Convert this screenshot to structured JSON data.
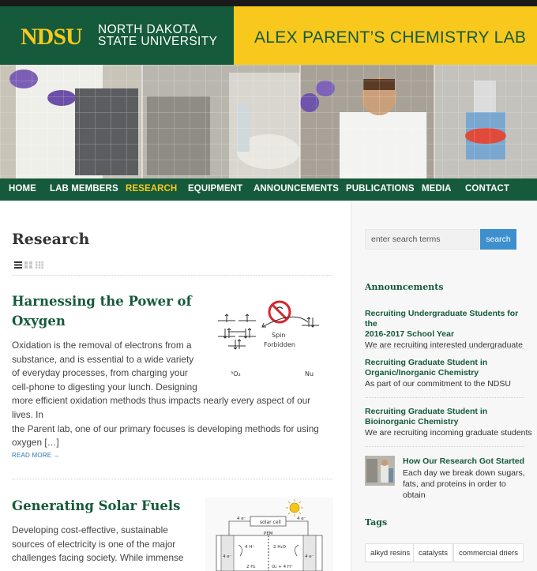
{
  "header": {
    "logo": "NDSU",
    "university_line1": "NORTH DAKOTA",
    "university_line2": "STATE UNIVERSITY",
    "lab_title": "ALEX PARENT’S CHEMISTRY LAB"
  },
  "nav": {
    "items": [
      {
        "label": "HOME"
      },
      {
        "label": "LAB MEMBERS"
      },
      {
        "label": "RESEARCH",
        "active": true
      },
      {
        "label": "EQUIPMENT"
      },
      {
        "label": "ANNOUNCEMENTS"
      },
      {
        "label": "PUBLICATIONS"
      },
      {
        "label": "MEDIA"
      },
      {
        "label": "CONTACT"
      }
    ]
  },
  "main": {
    "page_title": "Research",
    "posts": [
      {
        "title_line1": "Harnessing the Power of",
        "title_line2": "Oxygen",
        "excerpt_lines": [
          "Oxidation is the removal of electrons from a",
          "substance, and is essential to a wide variety",
          "of everyday processes, from charging your",
          "cell-phone to digesting your lunch. Designing",
          "more efficient oxidation methods thus impacts nearly every aspect of our lives. In",
          "the Parent lab, one of our primary focuses is developing methods for using",
          "oxygen […]"
        ],
        "read_more": "READ MORE →",
        "figure": {
          "spin_label_1": "Spin",
          "spin_label_2": "Forbidden",
          "label_o2": "³O₂",
          "label_nu": "Nu"
        }
      },
      {
        "title": "Generating Solar Fuels",
        "excerpt_lines": [
          "Developing cost-effective, sustainable",
          "sources of electricity is one of the major",
          "challenges facing society. While immense"
        ],
        "figure": {
          "solar_cell": "solar cell",
          "pem": "PEM",
          "e4_left": "4 e⁻",
          "e4_right": "4 e⁻",
          "h_plus": "4 H⁺",
          "h2o": "2 H₂O",
          "h2": "2 H₂",
          "o2": "O₂ + 4 H⁺",
          "e_side_left": "4 e⁻",
          "e_side_right": "4 e⁻"
        }
      }
    ]
  },
  "sidebar": {
    "search": {
      "placeholder": "enter search terms",
      "button": "search"
    },
    "announcements_title": "Announcements",
    "announcements": [
      {
        "title_line1": "Recruiting Undergraduate Students for the",
        "title_line2": "2016-2017 School Year",
        "summary": "We are recruiting interested undergraduate"
      },
      {
        "title_line1": "Recruiting Graduate Student in",
        "title_line2": "Organic/Inorganic Chemistry",
        "summary": "As part of our commitment to the NDSU"
      },
      {
        "title_line1": "Recruiting Graduate Student in",
        "title_line2": "Bioinorganic Chemistry",
        "summary": "We are recruiting incoming graduate students"
      }
    ],
    "story": {
      "title": "How Our Research Got Started",
      "summary": "Each day we break down sugars, fats, and proteins in order to obtain"
    },
    "tags_title": "Tags",
    "tags": [
      "alkyd resins",
      "catalysts",
      "commercial driers"
    ]
  },
  "colors": {
    "green": "#155a3a",
    "gold": "#f8c81d",
    "link_blue": "#2c74b3",
    "button_blue": "#3d8fce"
  }
}
